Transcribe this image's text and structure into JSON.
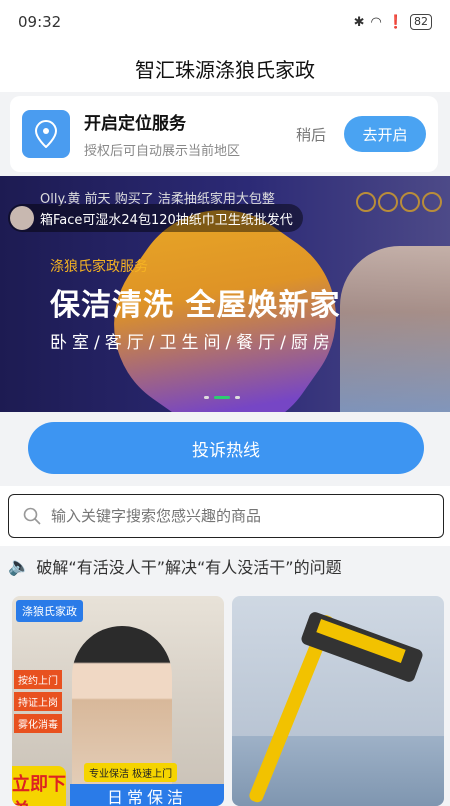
{
  "status_bar": {
    "time": "09:32",
    "battery": "82"
  },
  "header": {
    "title": "智汇珠源涤狼氏家政"
  },
  "location_card": {
    "title": "开启定位服务",
    "subtitle": "授权后可自动展示当前地区",
    "later_label": "稍后",
    "enable_label": "去开启"
  },
  "banner": {
    "ticker_top": "Olly.黄 前天 购买了 洁柔抽纸家用大包整",
    "ticker_text": "箱Face可湿水24包120抽纸巾卫生纸批发代",
    "brand": "涤狼氏家政服务",
    "title": "保洁清洗 全屋焕新家",
    "rooms": "卧室/客厅/卫生间/餐厅/厨房"
  },
  "complaint_button": {
    "label": "投诉热线"
  },
  "search": {
    "placeholder": "输入关键字搜索您感兴趣的商品"
  },
  "notice": {
    "text": "破解“有活没人干”解决“有人没活干”的问题"
  },
  "product_cards": {
    "left": {
      "brand_tag": "涤狼氏家政",
      "chips": [
        "按约上门",
        "持证上岗",
        "雾化消毒"
      ],
      "order_label": "立即下单",
      "pro_tag": "专业保洁 极速上门",
      "daily_label": "日常保洁"
    }
  }
}
